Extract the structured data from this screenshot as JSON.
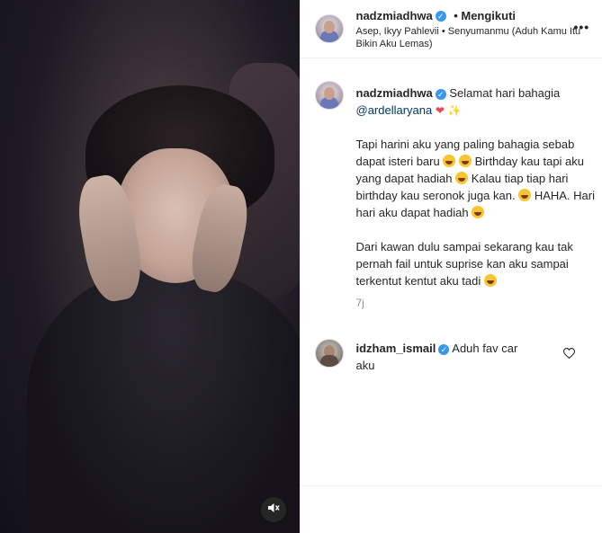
{
  "post_header": {
    "username": "nadzmiadhwa",
    "follow_status": "• Mengikuti",
    "audio_line": "Asep, Ikyy Pahlevii • Senyumanmu (Aduh Kamu Itu Bikin Aku Lemas)",
    "more_label": "•••"
  },
  "caption": {
    "username": "nadzmiadhwa",
    "greeting": "Selamat hari bahagia",
    "mention": "@ardellaryana",
    "para2_a": "Tapi harini aku yang paling bahagia sebab dapat isteri baru",
    "para2_b": "Birthday kau tapi aku yang dapat hadiah",
    "para2_c": "Kalau tiap tiap hari birthday kau seronok juga kan.",
    "para2_d": "HAHA. Hari hari aku dapat hadiah",
    "para3": "Dari kawan dulu sampai sekarang kau tak pernah fail untuk suprise kan aku sampai terkentut kentut aku tadi",
    "time": "7j"
  },
  "comment": {
    "username": "idzham_ismail",
    "text": "Aduh fav car aku"
  },
  "icons": {
    "verified": "verified-badge-icon",
    "mute": "sound-off-icon",
    "like": "heart-outline-icon"
  },
  "colors": {
    "verified_blue": "#3897f0",
    "mention_blue": "#00376b",
    "heart_red": "#ed4956"
  }
}
